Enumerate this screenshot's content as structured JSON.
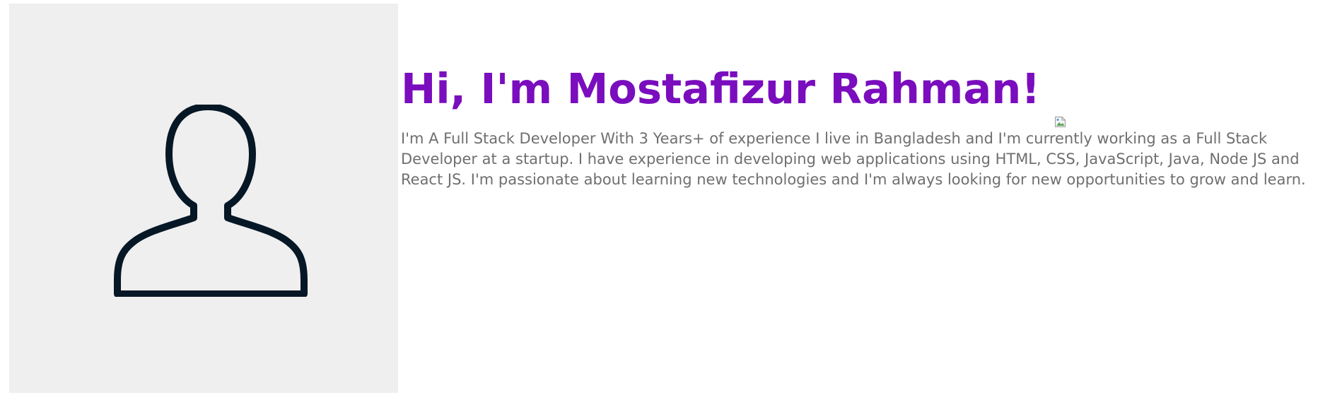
{
  "profile": {
    "avatar_icon": "user-silhouette-icon",
    "avatar_bg": "#efefef",
    "avatar_stroke": "#061726"
  },
  "intro": {
    "headline": "Hi, I'm Mostafizur Rahman!",
    "headline_color": "#7a0dbd",
    "wave_image_icon": "broken-image-icon",
    "bio": "I'm A Full Stack Developer With 3 Years+ of experience I live in Bangladesh and I'm currently working as a Full Stack Developer at a startup. I have experience in developing web applications using HTML, CSS, JavaScript, Java, Node JS and React JS. I'm passionate about learning new technologies and I'm always looking for new opportunities to grow and learn.",
    "bio_color": "#6f6f6f"
  }
}
